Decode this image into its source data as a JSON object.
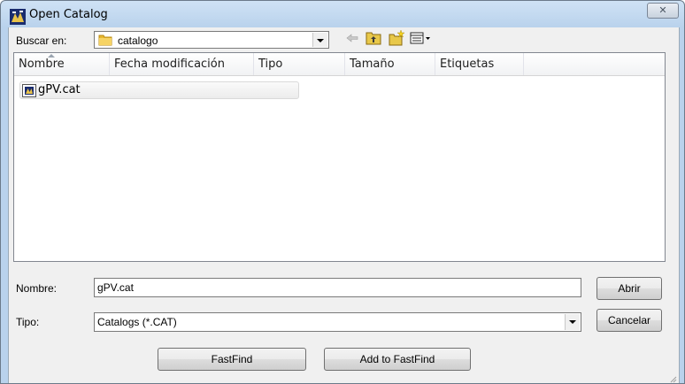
{
  "window": {
    "title": "Open Catalog",
    "close_glyph": "✕"
  },
  "lookin": {
    "label": "Buscar en:",
    "value": "catalogo"
  },
  "toolbar": {
    "icons": [
      "back-arrow-icon",
      "up-folder-icon",
      "new-folder-icon",
      "view-menu-icon"
    ]
  },
  "filelist": {
    "columns": [
      "Nombre",
      "Fecha modificación",
      "Tipo",
      "Tamaño",
      "Etiquetas"
    ],
    "items": [
      {
        "name": "gPV.cat"
      }
    ]
  },
  "filename": {
    "label": "Nombre:",
    "value": "gPV.cat"
  },
  "filetype": {
    "label": "Tipo:",
    "value": "Catalogs (*.CAT)"
  },
  "buttons": {
    "open": "Abrir",
    "cancel": "Cancelar",
    "fastfind": "FastFind",
    "add_fastfind": "Add to FastFind"
  }
}
